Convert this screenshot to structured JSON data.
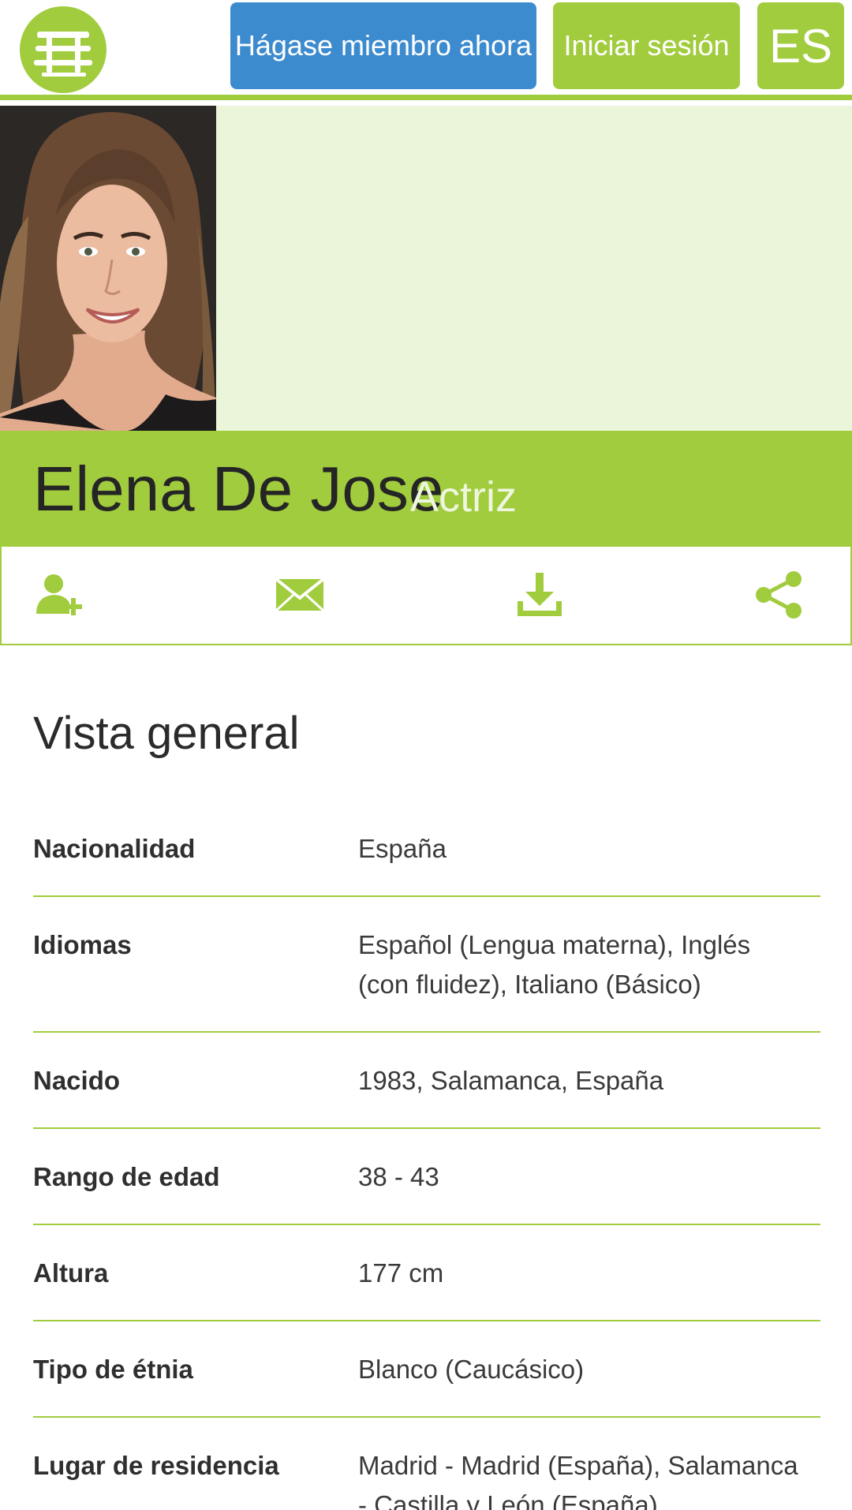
{
  "header": {
    "logo_icon": "bench-icon",
    "join_label": "Hágase miembro ahora",
    "login_label": "Iniciar sesión",
    "lang_label": "ES"
  },
  "profile": {
    "name": "Elena De Jose",
    "role": "Actriz"
  },
  "actions": {
    "icons": [
      "add-contact-icon",
      "mail-icon",
      "download-icon",
      "share-icon"
    ]
  },
  "overview": {
    "title": "Vista general",
    "rows": [
      {
        "label": "Nacionalidad",
        "value": "España"
      },
      {
        "label": "Idiomas",
        "value": "Español (Lengua materna), Inglés (con fluidez), Italiano (Básico)"
      },
      {
        "label": "Nacido",
        "value": "1983, Salamanca, España"
      },
      {
        "label": "Rango de edad",
        "value": "38 - 43"
      },
      {
        "label": "Altura",
        "value": "177 cm"
      },
      {
        "label": "Tipo de étnia",
        "value": "Blanco (Caucásico)"
      },
      {
        "label": "Lugar de residencia",
        "value": "Madrid - Madrid (España), Salamanca - Castilla y León (España)"
      }
    ]
  },
  "colors": {
    "accent": "#a1cc3e",
    "primary": "#3d8bcf",
    "hero_bg": "#eaf5d9"
  }
}
